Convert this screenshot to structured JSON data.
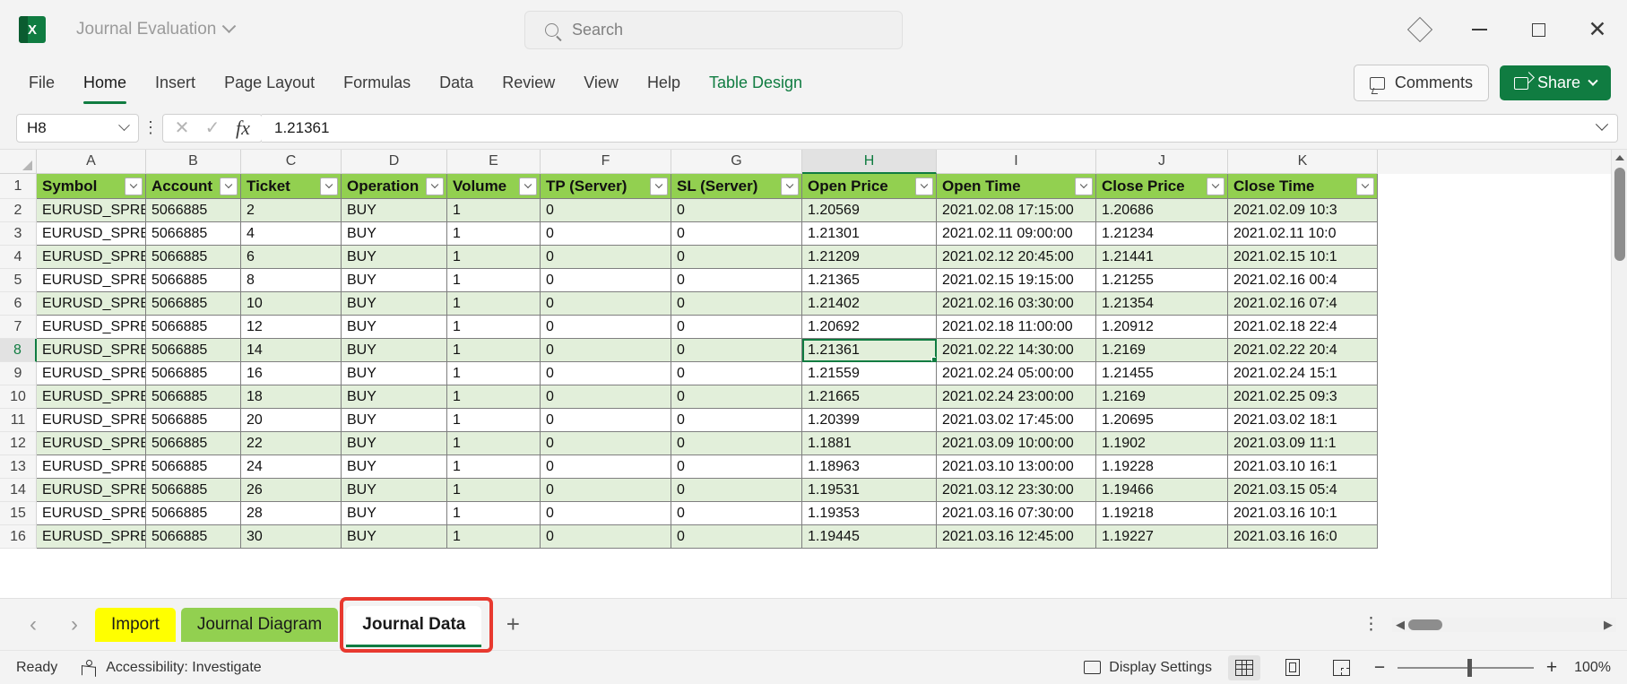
{
  "titlebar": {
    "app_icon": "excel-logo",
    "doc_title": "Journal Evaluation",
    "search_placeholder": "Search",
    "search_icon": "search-icon",
    "diamond_icon": "diamond-icon",
    "minimize": "–",
    "maximize": "□",
    "close": "✕"
  },
  "ribbon": {
    "tabs": [
      {
        "label": "File",
        "state": "normal"
      },
      {
        "label": "Home",
        "state": "active"
      },
      {
        "label": "Insert",
        "state": "normal"
      },
      {
        "label": "Page Layout",
        "state": "normal"
      },
      {
        "label": "Formulas",
        "state": "normal"
      },
      {
        "label": "Data",
        "state": "normal"
      },
      {
        "label": "Review",
        "state": "normal"
      },
      {
        "label": "View",
        "state": "normal"
      },
      {
        "label": "Help",
        "state": "normal"
      },
      {
        "label": "Table Design",
        "state": "contextual"
      }
    ],
    "comments_label": "Comments",
    "share_label": "Share"
  },
  "formula_bar": {
    "name_box_value": "H8",
    "cancel_icon": "✕",
    "enter_icon": "✓",
    "function_icon": "fx",
    "formula_value": "1.21361"
  },
  "grid": {
    "column_letters": [
      "A",
      "B",
      "C",
      "D",
      "E",
      "F",
      "G",
      "H",
      "I",
      "J",
      "K"
    ],
    "selected_column": "H",
    "selected_row": 8,
    "active_cell": "H8",
    "headers": [
      "Symbol",
      "Account",
      "Ticket",
      "Operation",
      "Volume",
      "TP (Server)",
      "SL (Server)",
      "Open Price",
      "Open Time",
      "Close Price",
      "Close Time"
    ],
    "rows": [
      {
        "n": 2,
        "cells": [
          "EURUSD_SPRE",
          "5066885",
          "2",
          "BUY",
          "1",
          "0",
          "0",
          "1.20569",
          "2021.02.08 17:15:00",
          "1.20686",
          "2021.02.09 10:3"
        ]
      },
      {
        "n": 3,
        "cells": [
          "EURUSD_SPRE",
          "5066885",
          "4",
          "BUY",
          "1",
          "0",
          "0",
          "1.21301",
          "2021.02.11 09:00:00",
          "1.21234",
          "2021.02.11 10:0"
        ]
      },
      {
        "n": 4,
        "cells": [
          "EURUSD_SPRE",
          "5066885",
          "6",
          "BUY",
          "1",
          "0",
          "0",
          "1.21209",
          "2021.02.12 20:45:00",
          "1.21441",
          "2021.02.15 10:1"
        ]
      },
      {
        "n": 5,
        "cells": [
          "EURUSD_SPRE",
          "5066885",
          "8",
          "BUY",
          "1",
          "0",
          "0",
          "1.21365",
          "2021.02.15 19:15:00",
          "1.21255",
          "2021.02.16 00:4"
        ]
      },
      {
        "n": 6,
        "cells": [
          "EURUSD_SPRE",
          "5066885",
          "10",
          "BUY",
          "1",
          "0",
          "0",
          "1.21402",
          "2021.02.16 03:30:00",
          "1.21354",
          "2021.02.16 07:4"
        ]
      },
      {
        "n": 7,
        "cells": [
          "EURUSD_SPRE",
          "5066885",
          "12",
          "BUY",
          "1",
          "0",
          "0",
          "1.20692",
          "2021.02.18 11:00:00",
          "1.20912",
          "2021.02.18 22:4"
        ]
      },
      {
        "n": 8,
        "cells": [
          "EURUSD_SPRE",
          "5066885",
          "14",
          "BUY",
          "1",
          "0",
          "0",
          "1.21361",
          "2021.02.22 14:30:00",
          "1.2169",
          "2021.02.22 20:4"
        ]
      },
      {
        "n": 9,
        "cells": [
          "EURUSD_SPRE",
          "5066885",
          "16",
          "BUY",
          "1",
          "0",
          "0",
          "1.21559",
          "2021.02.24 05:00:00",
          "1.21455",
          "2021.02.24 15:1"
        ]
      },
      {
        "n": 10,
        "cells": [
          "EURUSD_SPRE",
          "5066885",
          "18",
          "BUY",
          "1",
          "0",
          "0",
          "1.21665",
          "2021.02.24 23:00:00",
          "1.2169",
          "2021.02.25 09:3"
        ]
      },
      {
        "n": 11,
        "cells": [
          "EURUSD_SPRE",
          "5066885",
          "20",
          "BUY",
          "1",
          "0",
          "0",
          "1.20399",
          "2021.03.02 17:45:00",
          "1.20695",
          "2021.03.02 18:1"
        ]
      },
      {
        "n": 12,
        "cells": [
          "EURUSD_SPRE",
          "5066885",
          "22",
          "BUY",
          "1",
          "0",
          "0",
          "1.1881",
          "2021.03.09 10:00:00",
          "1.1902",
          "2021.03.09 11:1"
        ]
      },
      {
        "n": 13,
        "cells": [
          "EURUSD_SPRE",
          "5066885",
          "24",
          "BUY",
          "1",
          "0",
          "0",
          "1.18963",
          "2021.03.10 13:00:00",
          "1.19228",
          "2021.03.10 16:1"
        ]
      },
      {
        "n": 14,
        "cells": [
          "EURUSD_SPRE",
          "5066885",
          "26",
          "BUY",
          "1",
          "0",
          "0",
          "1.19531",
          "2021.03.12 23:30:00",
          "1.19466",
          "2021.03.15 05:4"
        ]
      },
      {
        "n": 15,
        "cells": [
          "EURUSD_SPRE",
          "5066885",
          "28",
          "BUY",
          "1",
          "0",
          "0",
          "1.19353",
          "2021.03.16 07:30:00",
          "1.19218",
          "2021.03.16 10:1"
        ]
      },
      {
        "n": 16,
        "cells": [
          "EURUSD_SPRE",
          "5066885",
          "30",
          "BUY",
          "1",
          "0",
          "0",
          "1.19445",
          "2021.03.16 12:45:00",
          "1.19227",
          "2021.03.16 16:0"
        ]
      }
    ]
  },
  "sheet_tabs": {
    "prev_icon": "‹",
    "next_icon": "›",
    "tabs": [
      {
        "label": "Import",
        "color": "#ffff00",
        "active": false
      },
      {
        "label": "Journal Diagram",
        "color": "#92d050",
        "active": false
      },
      {
        "label": "Journal Data",
        "color": "#ffffff",
        "active": true
      }
    ],
    "add_sheet_icon": "+",
    "options_icon": "⋮"
  },
  "status_bar": {
    "state": "Ready",
    "accessibility": "Accessibility: Investigate",
    "display_settings": "Display Settings",
    "view_normal_icon": "grid-view-icon",
    "view_pagelayout_icon": "page-layout-icon",
    "view_pagebreak_icon": "page-break-icon",
    "zoom_out": "−",
    "zoom_in": "+",
    "zoom_level": "100%"
  },
  "colors": {
    "brand_green": "#107c41",
    "table_header_green": "#92d050",
    "band_green": "#e2efda",
    "highlight_red": "#e8392f",
    "import_yellow": "#ffff00"
  }
}
